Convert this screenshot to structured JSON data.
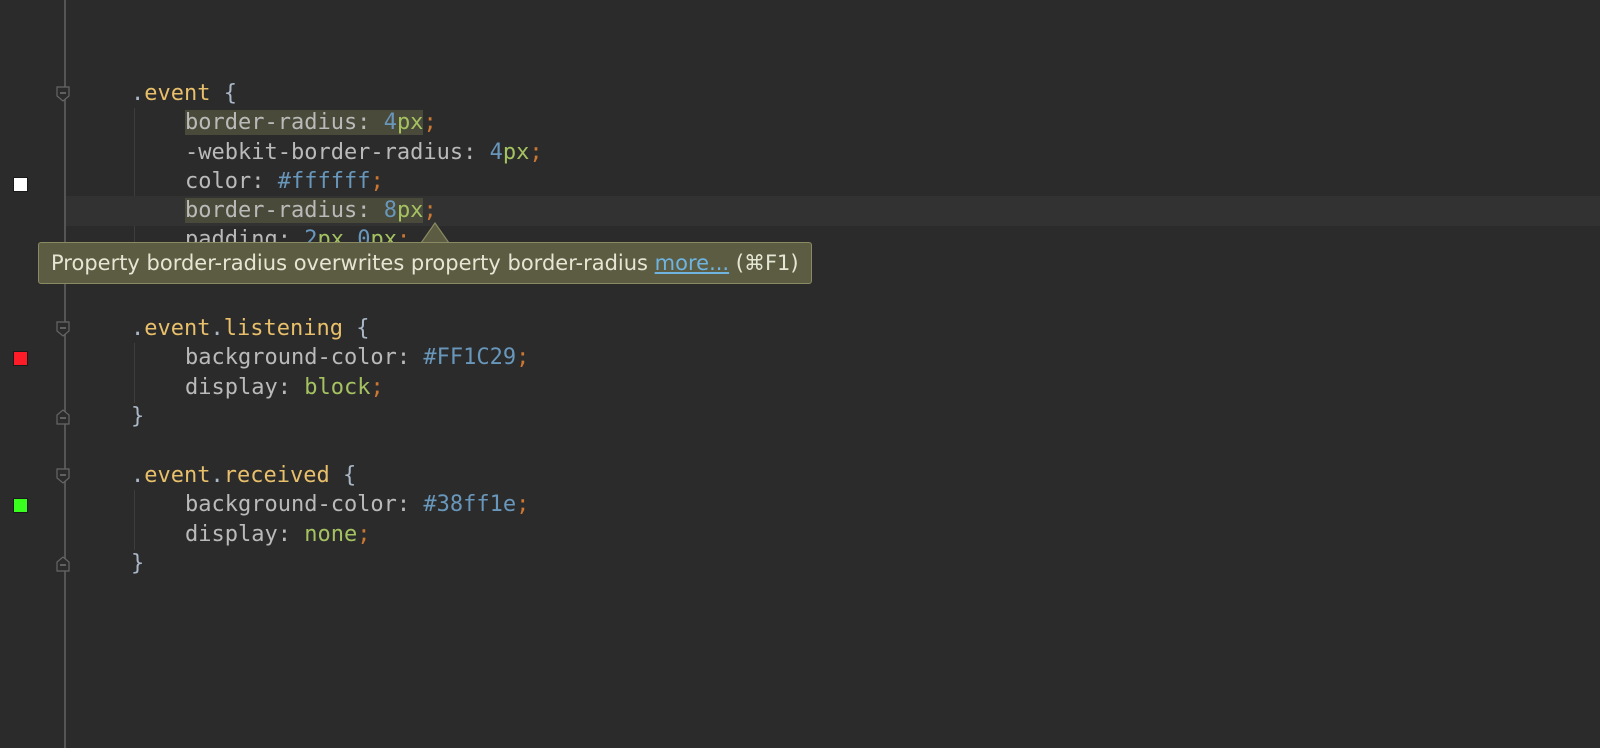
{
  "editor": {
    "lines": {
      "l1": {
        "selector_dot": ".",
        "selector": "event",
        "brace": " {"
      },
      "l2": {
        "prop": "border-radius: ",
        "num": "4",
        "unit": "px",
        "semi": ";"
      },
      "l3": {
        "prop": "-webkit-border-radius: ",
        "num": "4",
        "unit": "px",
        "semi": ";"
      },
      "l4": {
        "prop": "color: ",
        "hex": "#ffffff",
        "semi": ";"
      },
      "l5": {
        "prop": "border-radius: ",
        "num": "8",
        "unit": "px",
        "semi": ";"
      },
      "l6": {
        "prop": "padding: ",
        "num1": "2",
        "unit1": "px",
        "space": " ",
        "num2": "0",
        "unit2": "px",
        "semi": ";"
      },
      "l9": {
        "dot1": ".",
        "sel1": "event",
        "dot2": ".",
        "sel2": "listening",
        "brace": " {"
      },
      "l10": {
        "prop": "background-color: ",
        "hex": "#FF1C29",
        "semi": ";"
      },
      "l11": {
        "prop": "display: ",
        "kw": "block",
        "semi": ";"
      },
      "l12": {
        "brace": "}"
      },
      "l14": {
        "dot1": ".",
        "sel1": "event",
        "dot2": ".",
        "sel2": "received",
        "brace": " {"
      },
      "l15": {
        "prop": "background-color: ",
        "hex": "#38ff1e",
        "semi": ";"
      },
      "l16": {
        "prop": "display: ",
        "kw": "none",
        "semi": ";"
      },
      "l17": {
        "brace": "}"
      }
    },
    "swatches": {
      "white": "#ffffff",
      "red": "#FF1C29",
      "green": "#38ff1e"
    }
  },
  "tooltip": {
    "message": "Property border-radius overwrites property border-radius ",
    "link": "more...",
    "shortcut": " (⌘F1)"
  }
}
